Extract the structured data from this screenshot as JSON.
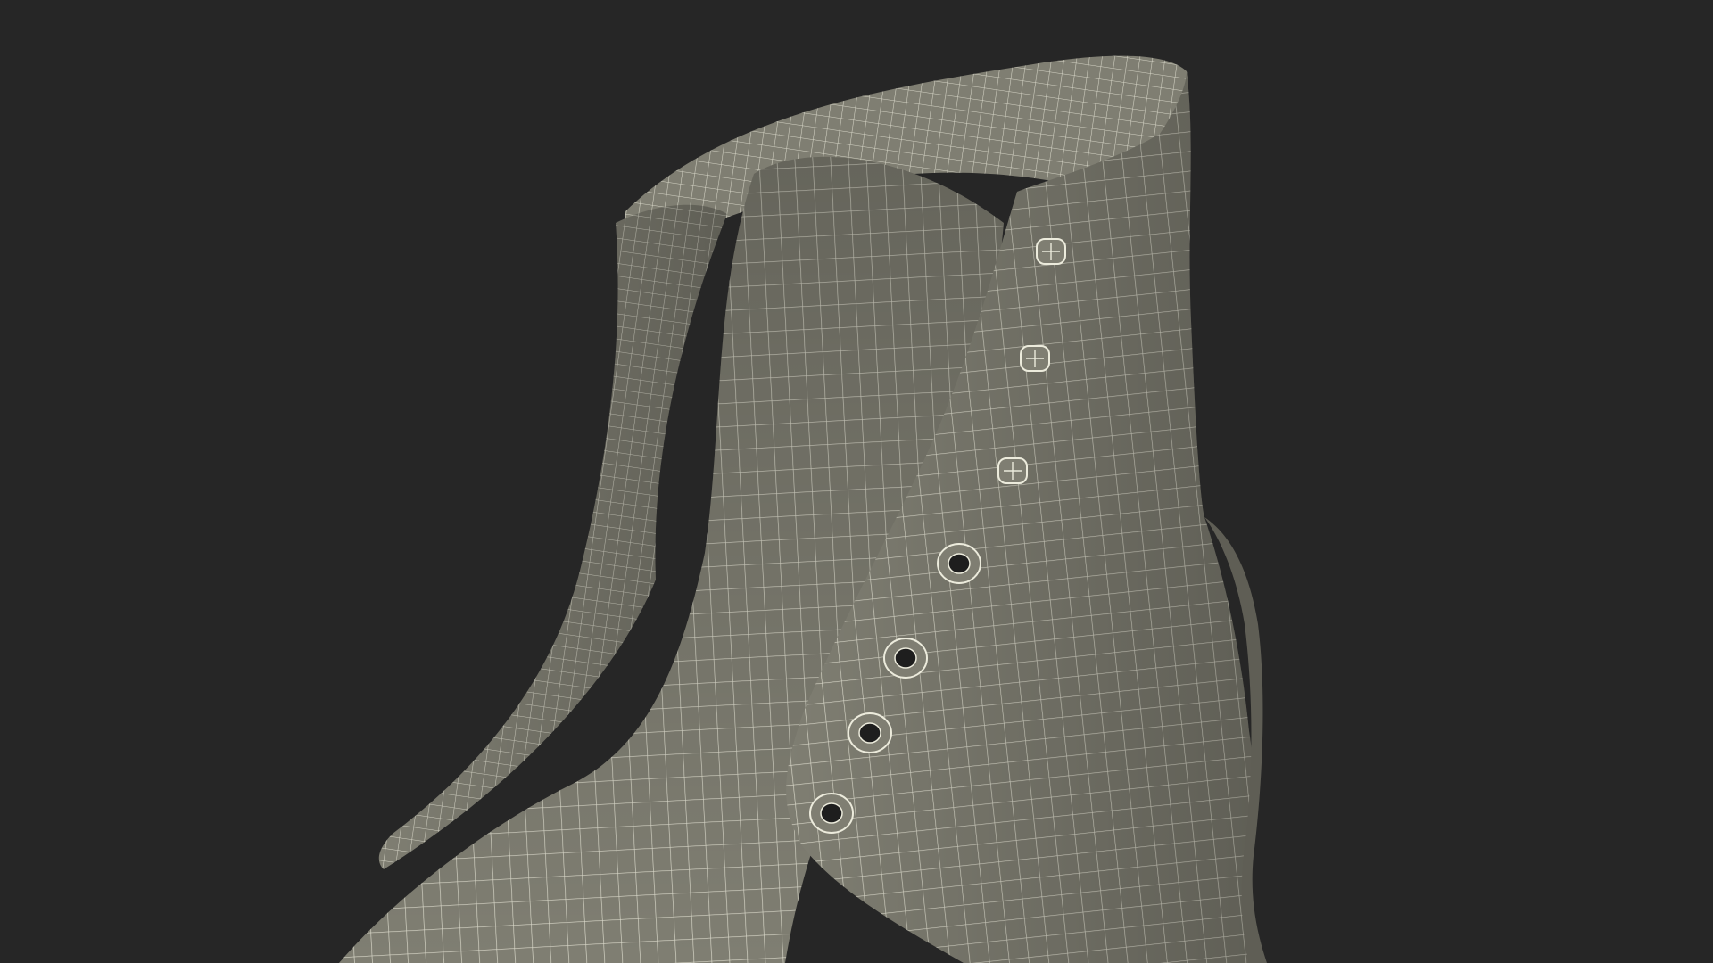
{
  "viewport": {
    "background_color": "#262626",
    "mesh_fill_color": "#7f7e72",
    "mesh_shade_color": "#5f5e55",
    "wire_color": "#ecebdc"
  },
  "model": {
    "subject": "boot-wireframe-render",
    "visible_eyelets": 4,
    "visible_speed_hooks": 3
  }
}
